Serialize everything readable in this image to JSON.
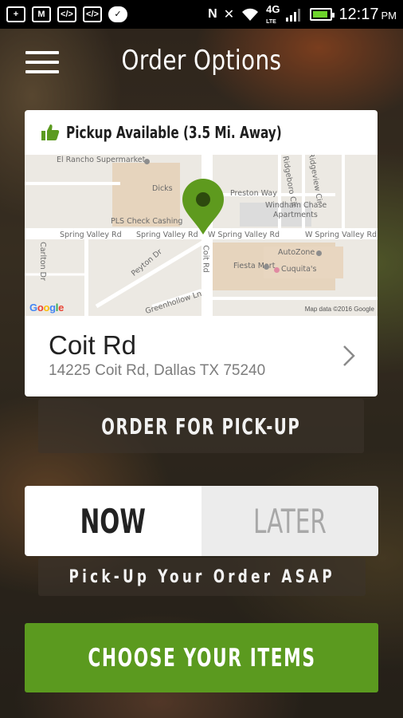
{
  "status_bar": {
    "left_icons": [
      "plus-icon",
      "mail-icon",
      "code-icon",
      "code-icon",
      "chat-icon"
    ],
    "network": "4G",
    "network_sub": "LTE",
    "time": "12:17",
    "ampm": "PM",
    "battery_level": 0.9
  },
  "header": {
    "title": "Order Options",
    "menu_icon": "hamburger-menu-icon"
  },
  "location": {
    "availability": "Pickup Available (3.5 Mi. Away)",
    "map": {
      "labels": {
        "el_rancho": "El Rancho Supermarket",
        "dicks": "Dicks",
        "preston_way": "Preston Way",
        "windham": "Windham Chase",
        "windham2": "Apartments",
        "pls": "PLS Check Cashing",
        "spring_valley_1": "Spring Valley Rd",
        "spring_valley_2": "Spring Valley Rd",
        "spring_valley_3": "W Spring Valley Rd",
        "spring_valley_4": "W Spring Valley Rd",
        "autozone": "AutoZone",
        "fiesta": "Fiesta Mart",
        "cuquitas": "Cuquita's",
        "carlton": "Carlton Dr",
        "peyton": "Peyton Dr",
        "coit": "Coit Rd",
        "greenhollow": "Greenhollow Ln",
        "ridgeboro": "Ridgeboro Cir",
        "ridgeview": "Ridgeview Cir"
      },
      "google": "Google",
      "map_data": "Map data ©2016 Google"
    },
    "store_name": "Coit Rd",
    "store_address": "14225 Coit Rd, Dallas TX 75240"
  },
  "actions": {
    "order_pickup": "ORDER FOR PICK-UP",
    "time_options": [
      "NOW",
      "LATER"
    ],
    "selected_time": "NOW",
    "asap_message": "Pick-Up Your Order ASAP",
    "choose_items": "CHOOSE YOUR ITEMS"
  },
  "colors": {
    "accent_green": "#5b9a1f",
    "map_pin": "#5e9a1e"
  }
}
